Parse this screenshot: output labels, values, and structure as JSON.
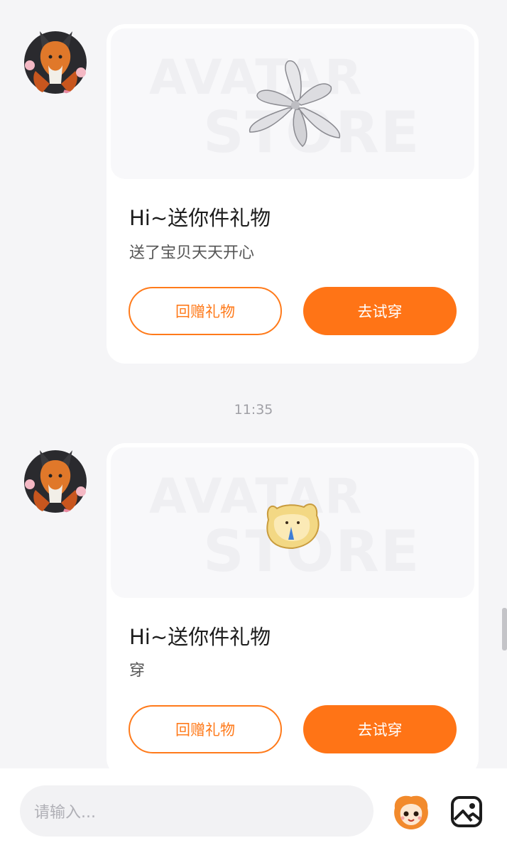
{
  "messages": [
    {
      "title": "Hi~送你件礼物",
      "subtitle": "送了宝贝天天开心",
      "watermark_line1": "AVATAR",
      "watermark_line2": "STORE",
      "return_gift_label": "回赠礼物",
      "try_on_label": "去试穿",
      "gift_icon": "lily-flower-icon"
    },
    {
      "title": "Hi~送你件礼物",
      "subtitle": "穿",
      "watermark_line1": "AVATAR",
      "watermark_line2": "STORE",
      "return_gift_label": "回赠礼物",
      "try_on_label": "去试穿",
      "gift_icon": "bread-cat-icon"
    }
  ],
  "timestamp": "11:35",
  "input": {
    "placeholder": "请输入..."
  },
  "colors": {
    "accent": "#ff7416",
    "background": "#f5f5f7",
    "card": "#ffffff"
  }
}
